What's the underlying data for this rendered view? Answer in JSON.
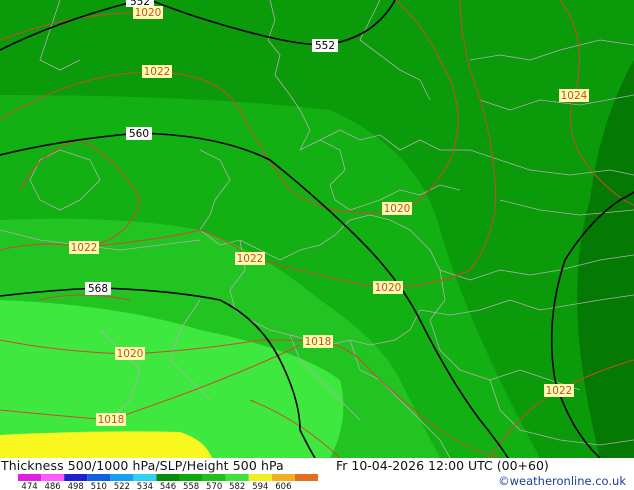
{
  "map": {
    "title": "Thickness 500/1000 hPa/SLP/Height 500 hPa",
    "valid_time": "Fr 10-04-2026 12:00 UTC (00+60)",
    "credit": "©weatheronline.co.uk",
    "height_contours": [
      {
        "id": "h552",
        "value": "552"
      },
      {
        "id": "h552b",
        "value": "552"
      },
      {
        "id": "h560",
        "value": "560"
      },
      {
        "id": "h568",
        "value": "568"
      }
    ],
    "slp_labels": [
      {
        "id": "p1020a",
        "value": "1020"
      },
      {
        "id": "p1022a",
        "value": "1022"
      },
      {
        "id": "p1024",
        "value": "1024"
      },
      {
        "id": "p1020b",
        "value": "1020"
      },
      {
        "id": "p1022b",
        "value": "1022"
      },
      {
        "id": "p1022c",
        "value": "1022"
      },
      {
        "id": "p1020c",
        "value": "1020"
      },
      {
        "id": "p1018a",
        "value": "1018"
      },
      {
        "id": "p1020d",
        "value": "1020"
      },
      {
        "id": "p1018b",
        "value": "1018"
      },
      {
        "id": "p1022d",
        "value": "1022"
      }
    ],
    "colors": {
      "darkest_green": "#047a04",
      "dark_green": "#0a9a0a",
      "mid_green": "#12b012",
      "light_green": "#28cc28",
      "lime": "#3ee83e",
      "yellow": "#f8f820",
      "slp_line": "#c84a30",
      "height_line": "#000000",
      "border": "#b0b0b0",
      "label_bg": "#ffffb0"
    },
    "scale": {
      "ticks": [
        "474",
        "486",
        "498",
        "510",
        "522",
        "534",
        "546",
        "558",
        "570",
        "582",
        "594",
        "606"
      ],
      "colors": [
        "#e020e0",
        "#ff5cff",
        "#2020d0",
        "#1060e0",
        "#18a0f0",
        "#30d0f0",
        "#0a8a0a",
        "#10a610",
        "#20c020",
        "#40e040",
        "#f0f020",
        "#f0b020",
        "#e07020"
      ]
    }
  }
}
